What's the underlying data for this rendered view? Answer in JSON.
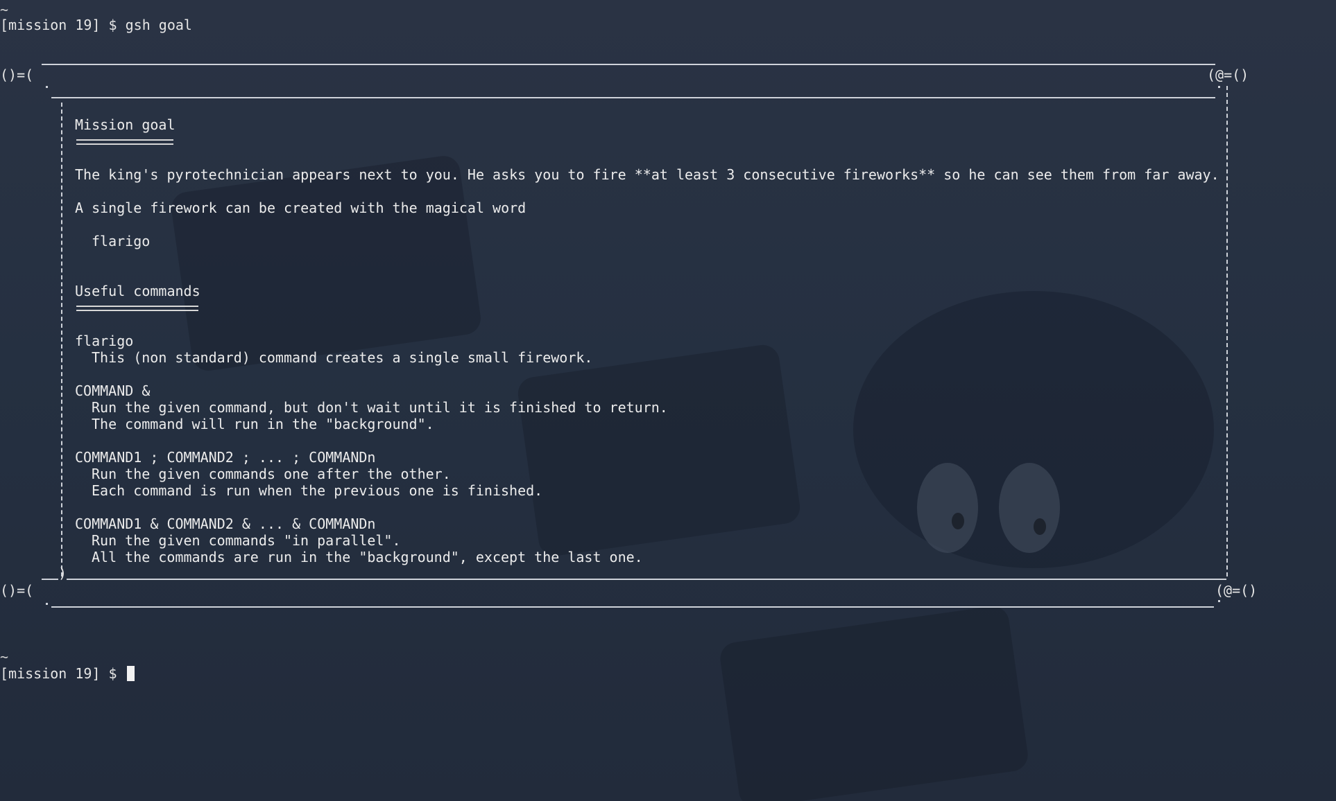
{
  "terminal": {
    "tilde_1": "~",
    "prompt_1": "[mission 19] $ gsh goal",
    "tilde_2": "~",
    "prompt_2": "[mission 19] $ "
  },
  "scroll": {
    "top_left_end": "()=(",
    "top_right_end": "(@=()",
    "bottom_left_end": "()=(",
    "bottom_right_end": "(@=()",
    "bottom_left_curl": ")"
  },
  "goal": {
    "heading": "Mission goal",
    "description": "The king's pyrotechnician appears next to you. He asks you to fire **at least 3 consecutive fireworks** so he can see them from far away.",
    "magic_intro": "A single firework can be created with the magical word",
    "magic_word": "flarigo"
  },
  "commands": {
    "heading": "Useful commands",
    "items": [
      {
        "syntax": "flarigo",
        "desc": [
          "This (non standard) command creates a single small firework."
        ]
      },
      {
        "syntax": "COMMAND &",
        "desc": [
          "Run the given command, but don't wait until it is finished to return.",
          "The command will run in the \"background\"."
        ]
      },
      {
        "syntax": "COMMAND1 ; COMMAND2 ; ... ; COMMANDn",
        "desc": [
          "Run the given commands one after the other.",
          "Each command is run when the previous one is finished."
        ]
      },
      {
        "syntax": "COMMAND1 & COMMAND2 & ... & COMMANDn",
        "desc": [
          "Run the given commands \"in parallel\".",
          "All the commands are run in the \"background\", except the last one."
        ]
      }
    ]
  },
  "colors": {
    "background": "#283142",
    "text": "#e6e6e6",
    "frame": "#cfd3da"
  }
}
